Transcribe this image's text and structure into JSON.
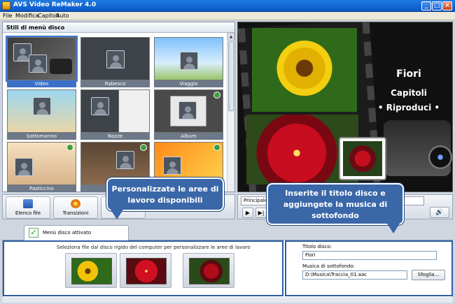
{
  "window": {
    "title": "AVS Video ReMaker 4.0"
  },
  "menu": [
    "File",
    "Modifica",
    "Capitoli",
    "Auto"
  ],
  "styles_panel": {
    "title": "Stili di menù disco",
    "styles": [
      {
        "name": "Video",
        "selected": true
      },
      {
        "name": "Rabesco",
        "selected": false
      },
      {
        "name": "Viaggio",
        "selected": false
      },
      {
        "name": "Sottomarino",
        "selected": false
      },
      {
        "name": "Nozze",
        "selected": false
      },
      {
        "name": "Album",
        "selected": false
      },
      {
        "name": "Pasticcino",
        "selected": false
      },
      {
        "name": "",
        "selected": false
      },
      {
        "name": "",
        "selected": false
      }
    ]
  },
  "preview": {
    "title": "Fiori",
    "items": [
      "Capitoli",
      "• Riproduci •"
    ]
  },
  "toolbar": {
    "buttons": [
      {
        "label": "Elenco file"
      },
      {
        "label": "Transizioni"
      }
    ]
  },
  "preview_controls": {
    "menu_value": "Principale"
  },
  "tab": {
    "label": "Menù disco attivato"
  },
  "files": {
    "instructions": "Seleziona file dal disco rigido del computer per personalizzare le aree di lavoro"
  },
  "disc_form": {
    "title_label": "Titolo disco:",
    "title_value": "Fiori",
    "music_label": "Musica di sottofondo:",
    "music_value": "D:\\Musica\\Traccia_01.aac",
    "browse_label": "Sfoglia..."
  },
  "callouts": {
    "left": "Personalizzate le aree di lavoro disponibili",
    "right": "Inserite il titolo disco e aggiungete la musica di sottofondo"
  },
  "colors": {
    "accent": "#3a67a8",
    "selection": "#3b6fc8"
  }
}
